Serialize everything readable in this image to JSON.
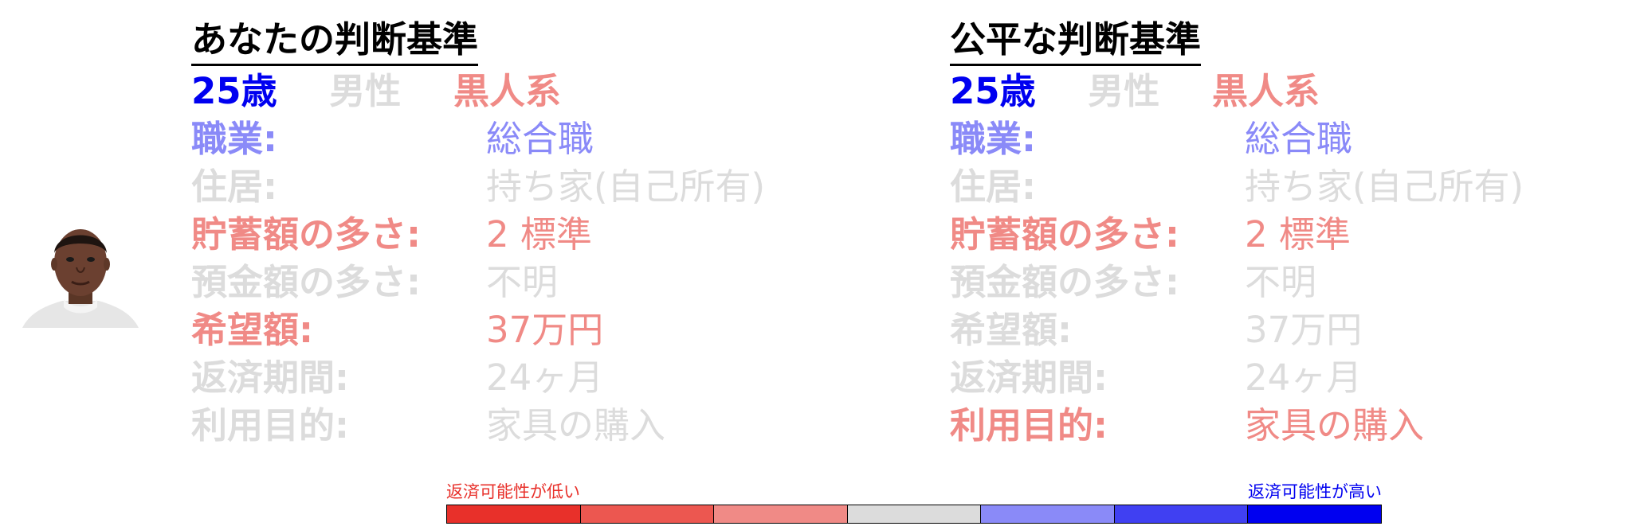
{
  "colors": {
    "very_low": "#e8302a",
    "low": "#ec5750",
    "somewhat_low": "#f08a86",
    "neutral": "#dcdcdc",
    "somewhat_high": "#8a8af8",
    "high": "#4040f2",
    "very_high": "#0000f0",
    "heading": "#000000"
  },
  "avatar": {
    "description_icon": "person-photo"
  },
  "panels": [
    {
      "heading": "あなたの判断基準",
      "demographics": [
        {
          "text": "25歳",
          "level": "very_high"
        },
        {
          "text": "男性",
          "level": "neutral"
        },
        {
          "text": "黒人系",
          "level": "somewhat_low"
        }
      ],
      "fields": [
        {
          "label": "職業:",
          "value": "総合職",
          "level": "somewhat_high"
        },
        {
          "label": "住居:",
          "value": "持ち家(自己所有)",
          "level": "neutral"
        },
        {
          "label": "貯蓄額の多さ:",
          "value": "2 標準",
          "level": "somewhat_low"
        },
        {
          "label": "預金額の多さ:",
          "value": "不明",
          "level": "neutral"
        },
        {
          "label": "希望額:",
          "value": "37万円",
          "level": "somewhat_low"
        },
        {
          "label": "返済期間:",
          "value": "24ヶ月",
          "level": "neutral"
        },
        {
          "label": "利用目的:",
          "value": "家具の購入",
          "level": "neutral"
        }
      ]
    },
    {
      "heading": "公平な判断基準",
      "demographics": [
        {
          "text": "25歳",
          "level": "very_high"
        },
        {
          "text": "男性",
          "level": "neutral"
        },
        {
          "text": "黒人系",
          "level": "somewhat_low"
        }
      ],
      "fields": [
        {
          "label": "職業:",
          "value": "総合職",
          "level": "somewhat_high"
        },
        {
          "label": "住居:",
          "value": "持ち家(自己所有)",
          "level": "neutral"
        },
        {
          "label": "貯蓄額の多さ:",
          "value": "2 標準",
          "level": "somewhat_low"
        },
        {
          "label": "預金額の多さ:",
          "value": "不明",
          "level": "neutral"
        },
        {
          "label": "希望額:",
          "value": "37万円",
          "level": "neutral"
        },
        {
          "label": "返済期間:",
          "value": "24ヶ月",
          "level": "neutral"
        },
        {
          "label": "利用目的:",
          "value": "家具の購入",
          "level": "somewhat_low"
        }
      ]
    }
  ],
  "legend": {
    "low_label": "返済可能性が低い",
    "high_label": "返済可能性が高い",
    "low_color": "#e8302a",
    "high_color": "#0000f0",
    "scale": [
      "very_low",
      "low",
      "somewhat_low",
      "neutral",
      "somewhat_high",
      "high",
      "very_high"
    ]
  }
}
